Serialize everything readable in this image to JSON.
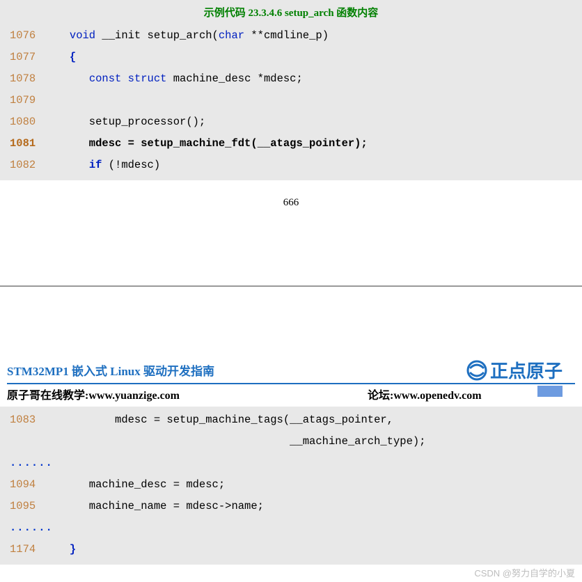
{
  "block1": {
    "title": "示例代码 23.3.4.6 setup_arch 函数内容",
    "lines": [
      {
        "n": "1076",
        "bold": false,
        "html": "   <span class='k-blue'>void</span> __init setup_arch(<span class='k-blue'>char</span> **cmdline_p)"
      },
      {
        "n": "1077",
        "bold": false,
        "html": "   <span class='k-blue-b'>{</span>"
      },
      {
        "n": "1078",
        "bold": false,
        "html": "      <span class='k-blue'>const</span> <span class='k-blue'>struct</span> machine_desc *mdesc;"
      },
      {
        "n": "1079",
        "bold": false,
        "html": ""
      },
      {
        "n": "1080",
        "bold": false,
        "html": "      setup_processor();"
      },
      {
        "n": "1081",
        "bold": true,
        "html": "      mdesc = setup_machine_fdt(__atags_pointer);"
      },
      {
        "n": "1082",
        "bold": false,
        "html": "      <span class='k-blue-b'>if</span> (!mdesc)"
      }
    ]
  },
  "page_number": "666",
  "header": {
    "doc_title": "STM32MP1 嵌入式 Linux 驱动开发指南",
    "logo_text": "正点原子",
    "sub_left_label": "原子哥在线教学:",
    "sub_left_url": "www.yuanzige.com",
    "sub_right_label": "论坛:",
    "sub_right_url": "www.openedv.com"
  },
  "block2": {
    "lines": [
      {
        "type": "code",
        "n": "1083",
        "html": "          mdesc = setup_machine_tags(__atags_pointer,"
      },
      {
        "type": "code",
        "n": "",
        "html": "                                     __machine_arch_type);"
      },
      {
        "type": "dots"
      },
      {
        "type": "code",
        "n": "1094",
        "html": "      machine_desc = mdesc;"
      },
      {
        "type": "code",
        "n": "1095",
        "html": "      machine_name = mdesc->name;"
      },
      {
        "type": "dots"
      },
      {
        "type": "code",
        "n": "1174",
        "html": "   <span class='k-blue-b'>}</span>"
      }
    ]
  },
  "watermark": "CSDN @努力自学的小夏"
}
